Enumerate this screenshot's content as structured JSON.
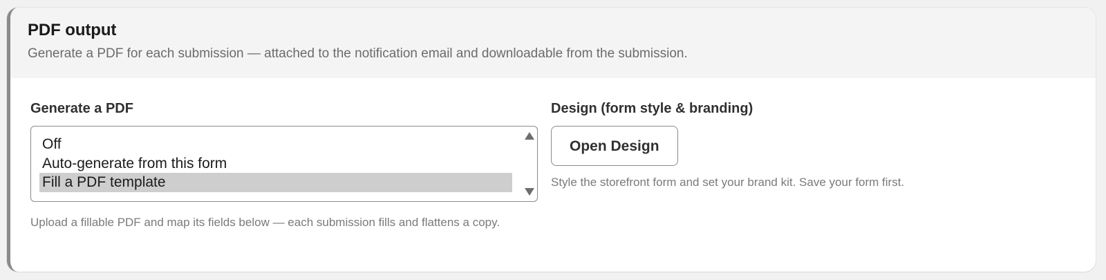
{
  "section": {
    "title": "PDF output",
    "subtitle": "Generate a PDF for each submission — attached to the notification email and downloadable from the submission."
  },
  "generate": {
    "label": "Generate a PDF",
    "options": [
      "Off",
      "Auto-generate from this form",
      "Fill a PDF template"
    ],
    "selected": "Fill a PDF template",
    "help": "Upload a fillable PDF and map its fields below — each submission fills and flattens a copy."
  },
  "design": {
    "label": "Design (form style & branding)",
    "button": "Open Design",
    "help": "Style the storefront form and set your brand kit. Save your form first."
  }
}
